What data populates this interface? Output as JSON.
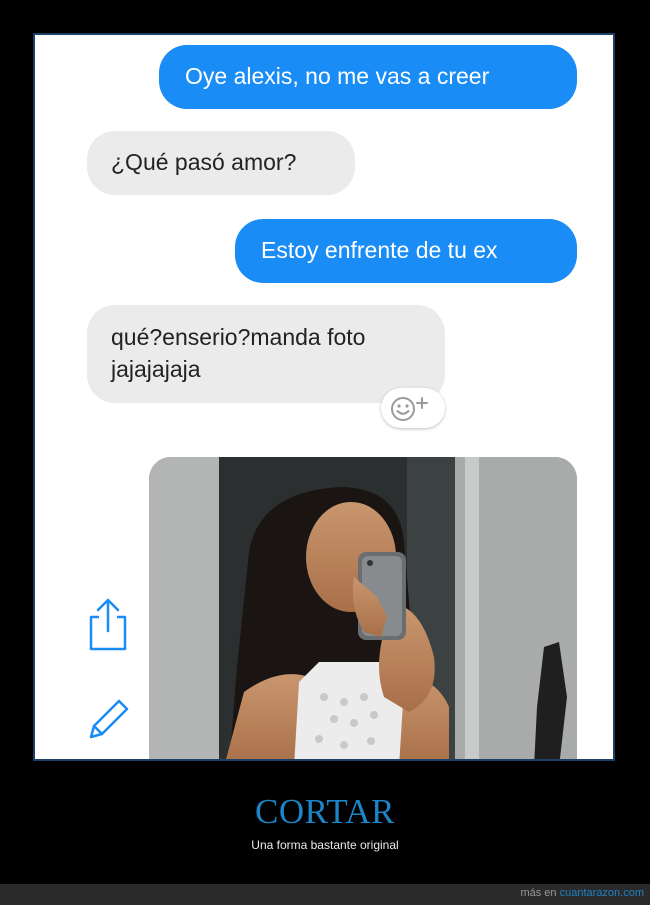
{
  "messages": [
    {
      "text": "Oye alexis, no me vas a creer",
      "sender": "me"
    },
    {
      "text": "¿Qué pasó amor?",
      "sender": "them"
    },
    {
      "text": "Estoy enfrente de tu ex",
      "sender": "me"
    },
    {
      "text": "qué?enserio?manda foto jajajajaja",
      "sender": "them"
    }
  ],
  "icons": {
    "reaction": "add-reaction-icon",
    "share": "share-icon",
    "edit": "pencil-icon"
  },
  "colors": {
    "outgoing_bubble": "#1a8cf5",
    "incoming_bubble": "#ebebeb",
    "title": "#1d84c6"
  },
  "post": {
    "title": "CORTAR",
    "subtitle": "Una forma bastante original"
  },
  "footer": {
    "prefix": "más en ",
    "link": "cuantarazon.com"
  }
}
